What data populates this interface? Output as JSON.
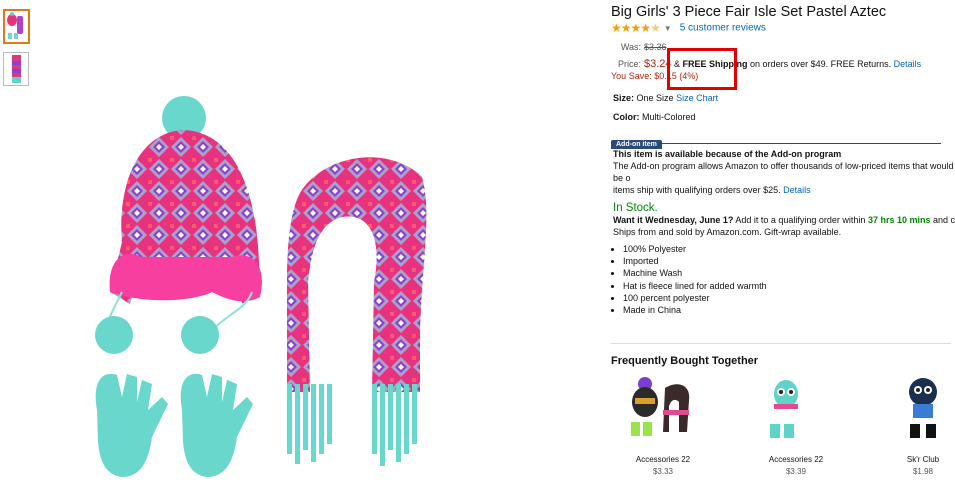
{
  "product": {
    "title": "Big Girls' 3 Piece Fair Isle Set Pastel Aztec",
    "stars": "★★★★",
    "reviews": "5 customer reviews"
  },
  "pricing": {
    "was_label": "Was:",
    "was_value": "$3.36",
    "price_label": "Price:",
    "price_value": "$3.24",
    "amp": " & ",
    "free_shipping": "FREE Shipping",
    "shipping_rest": " on orders over $49. FREE Returns.",
    "details": "Details",
    "save_label": "You Save:",
    "save_value": "$0.15 (4%)"
  },
  "size": {
    "label": "Size:",
    "value": "One Size",
    "chart_link": "Size Chart"
  },
  "color": {
    "label": "Color:",
    "value": "Multi-Colored"
  },
  "addon": {
    "badge": "Add-on item",
    "heading": "This item is available because of the Add-on program",
    "text": "The Add-on program allows Amazon to offer thousands of low-priced items that would be o",
    "text2": "items ship with qualifying orders over $25.",
    "details": "Details"
  },
  "stock": {
    "status": "In Stock.",
    "want_lead": "Want it Wednesday, June 1?",
    "want_mid": " Add it to a qualifying order within ",
    "countdown": "37 hrs 10 mins",
    "want_tail": " and choose",
    "ships": "Ships from and sold by Amazon.com. Gift-wrap available."
  },
  "bullets": [
    "100% Polyester",
    "Imported",
    "Machine Wash",
    "Hat is fleece lined for added warmth",
    "100 percent polyester",
    "Made in China"
  ],
  "fbt": {
    "title": "Frequently Bought Together",
    "items": [
      {
        "name": "Accessories 22",
        "price": "$3.33"
      },
      {
        "name": "Accessories 22",
        "price": "$3.39"
      },
      {
        "name": "Sk'r Club",
        "price": "$1.98"
      }
    ]
  },
  "colors": {
    "accent": "#e47911",
    "price": "#b12704",
    "link": "#0066c0",
    "instock": "#008a00",
    "highlight": "#e00000"
  }
}
